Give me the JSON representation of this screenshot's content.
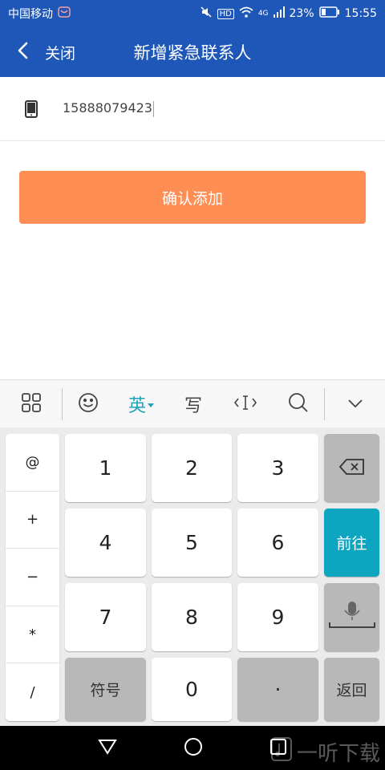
{
  "status_bar": {
    "carrier": "中国移动",
    "hd": "HD",
    "network": "4G",
    "battery": "23%",
    "time": "15:55"
  },
  "app_bar": {
    "close_label": "关闭",
    "title": "新增紧急联系人"
  },
  "form": {
    "phone_value": "15888079423"
  },
  "confirm_button": {
    "label": "确认添加"
  },
  "keyboard": {
    "toolbar": {
      "lang_label": "英",
      "write_label": "写"
    },
    "symbols": [
      "@",
      "+",
      "−",
      "*",
      "/"
    ],
    "digits": [
      "1",
      "2",
      "3",
      "4",
      "5",
      "6",
      "7",
      "8",
      "9",
      "0"
    ],
    "symbol_key_label": "符号",
    "dot_label": "·",
    "go_label": "前往",
    "return_label": "返回"
  },
  "watermark": {
    "text": "一听下载"
  },
  "colors": {
    "header_blue": "#1f57b8",
    "confirm_orange": "#ff8e54",
    "teal": "#0ea5c0"
  }
}
